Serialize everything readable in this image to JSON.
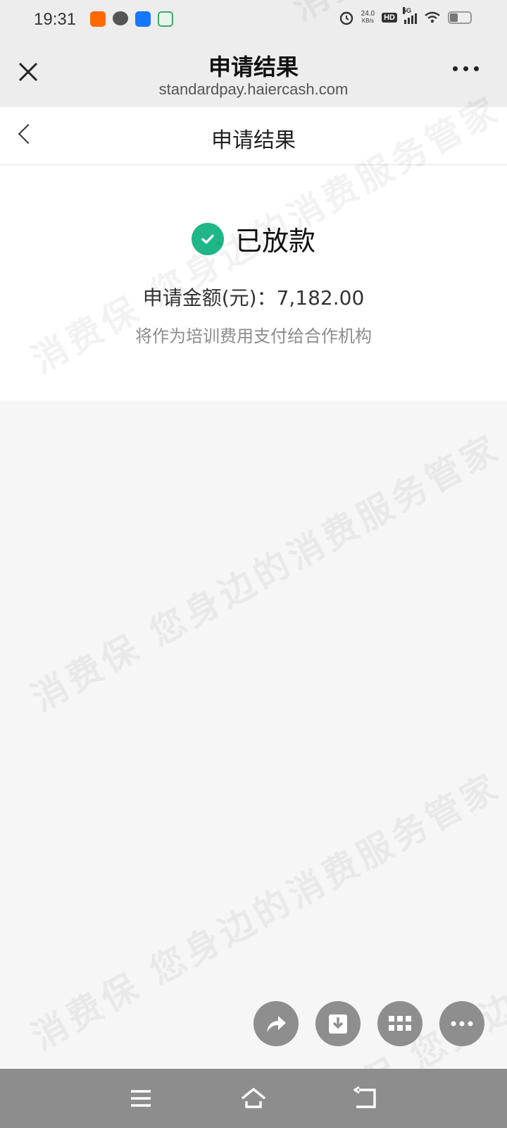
{
  "status_bar": {
    "time": "19:31",
    "net_speed_value": "24.0",
    "net_speed_unit": "KB/s",
    "hd_label": "HD",
    "network_type": "5G",
    "battery_level": 0.35,
    "notification_icons": [
      "taobao-icon",
      "chat-bubble-icon",
      "alipay-icon",
      "app-icon"
    ]
  },
  "web_header": {
    "title": "申请结果",
    "url": "standardpay.haiercash.com"
  },
  "page_nav": {
    "title": "申请结果"
  },
  "result": {
    "status": "已放款",
    "amount_label": "申请金额(元)：",
    "amount_value": "7,182.00",
    "note": "将作为培训费用支付给合作机构"
  },
  "watermark": {
    "text": "消费保 您身边的消费服务管家"
  },
  "colors": {
    "success": "#1fb688",
    "fab": "#8e8e8e",
    "sys_nav": "#8d8d8d"
  },
  "fab_icons": [
    "share-icon",
    "download-icon",
    "apps-grid-icon",
    "more-icon"
  ],
  "sys_nav_icons": [
    "menu-icon",
    "home-icon",
    "back-icon"
  ]
}
